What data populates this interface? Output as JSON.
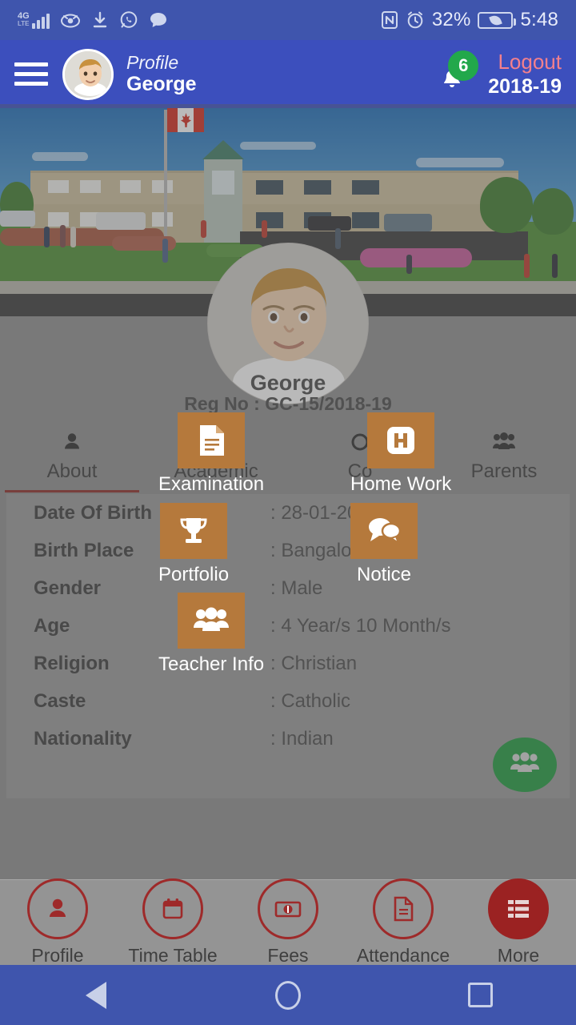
{
  "status_bar": {
    "network": "4G",
    "network_sub": "LTE",
    "icons": [
      "signal-icon",
      "eye-icon",
      "download-icon",
      "whatsapp-icon",
      "message-icon",
      "nfc-icon",
      "alarm-icon"
    ],
    "battery_percent": "32%",
    "time": "5:48"
  },
  "header": {
    "menu_icon": "hamburger-menu-icon",
    "avatar": "user-avatar",
    "role": "Profile",
    "name": "George",
    "notification_count": "6",
    "logout_label": "Logout",
    "academic_year": "2018-19"
  },
  "banner": {
    "alt": "school-building-banner"
  },
  "profile": {
    "name": "George",
    "reg_no": "Reg No : GC-15/2018-19"
  },
  "tabs": [
    {
      "label": "About",
      "icon": "person-icon",
      "active": true
    },
    {
      "label": "Academic",
      "icon": "book-icon",
      "active": false
    },
    {
      "label": "Co",
      "icon": "co-icon",
      "active": false
    },
    {
      "label": "Parents",
      "icon": "parents-icon",
      "active": false
    }
  ],
  "details": {
    "rows": [
      {
        "label": "Date Of Birth",
        "value": ": 28-01-201"
      },
      {
        "label": "Birth Place",
        "value": ": Bangalore"
      },
      {
        "label": "Gender",
        "value": ": Male"
      },
      {
        "label": "Age",
        "value": ": 4 Year/s 10 Month/s"
      },
      {
        "label": "Religion",
        "value": ": Christian"
      },
      {
        "label": "Caste",
        "value": ": Catholic"
      },
      {
        "label": "Nationality",
        "value": ": Indian"
      }
    ]
  },
  "fab": {
    "icon": "group-icon"
  },
  "overlay_menu": {
    "items": [
      {
        "label": "Examination",
        "icon": "document-icon"
      },
      {
        "label": "Home Work",
        "icon": "homework-h-icon"
      },
      {
        "label": "Portfolio",
        "icon": "trophy-icon"
      },
      {
        "label": "Notice",
        "icon": "chat-bubbles-icon"
      },
      {
        "label": "Teacher Info",
        "icon": "teachers-icon"
      }
    ]
  },
  "bottom_nav": [
    {
      "label": "Profile",
      "icon": "person-icon",
      "selected": false
    },
    {
      "label": "Time Table",
      "icon": "calendar-icon",
      "selected": false
    },
    {
      "label": "Fees",
      "icon": "money-icon",
      "selected": false
    },
    {
      "label": "Attendance",
      "icon": "document-icon",
      "selected": false
    },
    {
      "label": "More",
      "icon": "list-icon",
      "selected": true
    }
  ],
  "android_nav": [
    {
      "label": "back",
      "icon": "triangle-back-icon"
    },
    {
      "label": "home",
      "icon": "circle-home-icon"
    },
    {
      "label": "recent",
      "icon": "square-recents-icon"
    }
  ],
  "colors": {
    "statusbar": "#3f55ad",
    "header": "#3c4fbd",
    "accent_orange": "#b5793c",
    "accent_red": "#9e2a2a",
    "badge_green": "#22a84b",
    "fab_green": "#1f9b3f",
    "logout_pink": "#f4808c"
  }
}
